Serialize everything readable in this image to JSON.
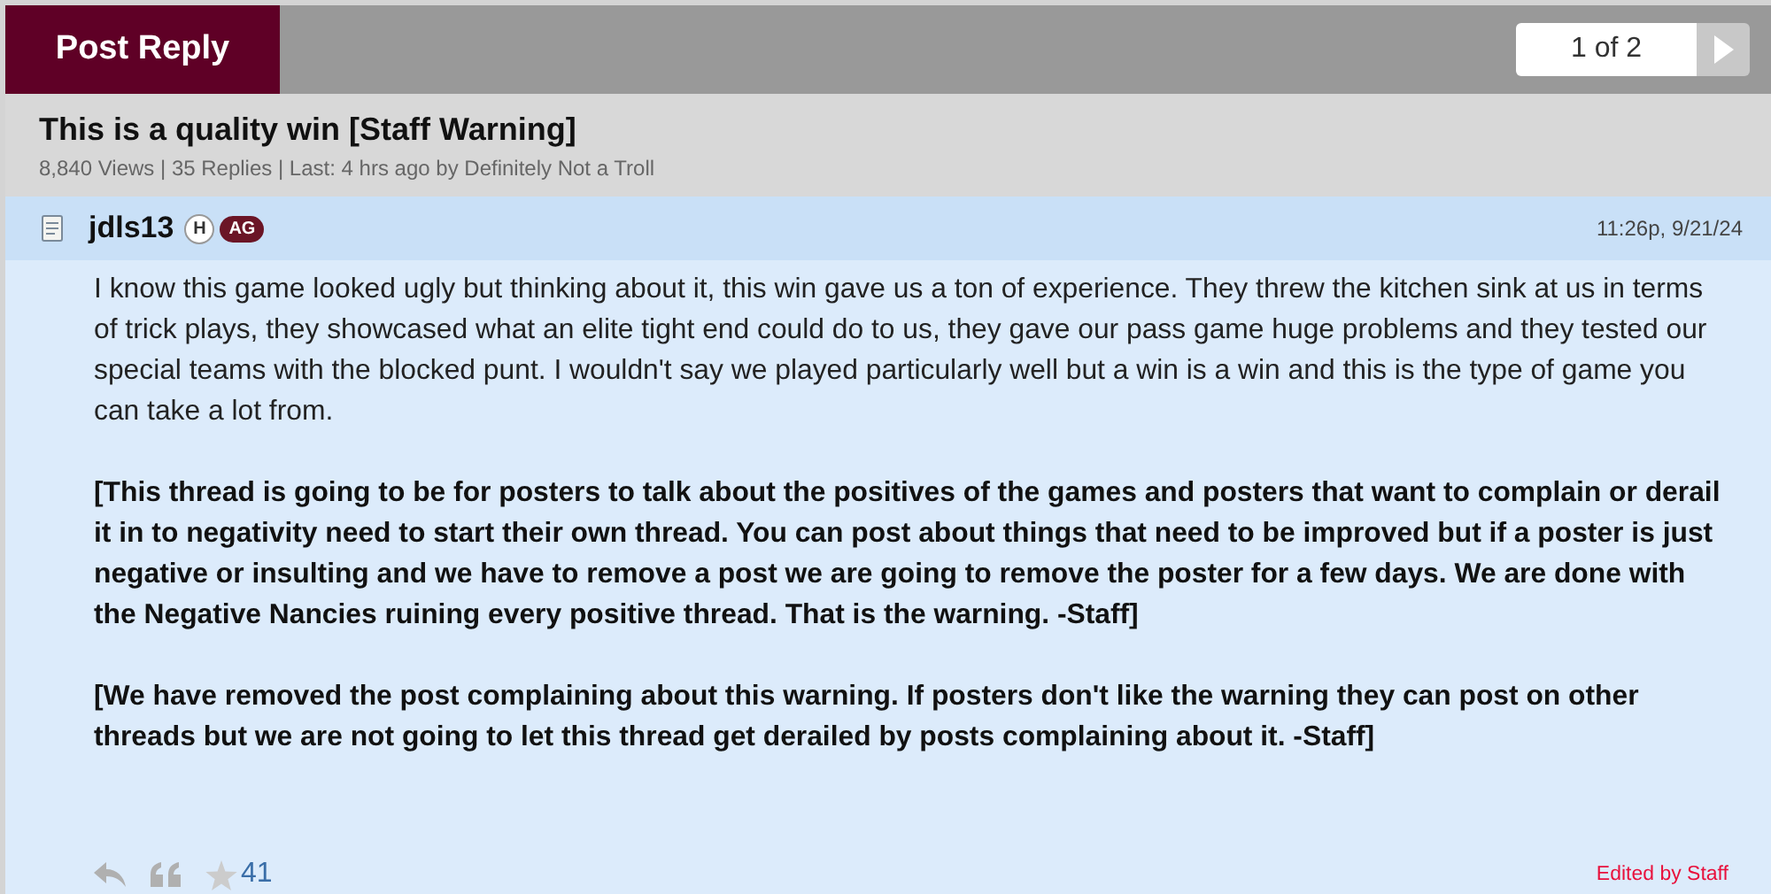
{
  "toolbar": {
    "post_reply": "Post Reply",
    "pager": "1 of 2"
  },
  "thread": {
    "title": "This is a quality win [Staff Warning]",
    "meta": "8,840 Views | 35 Replies | Last: 4 hrs ago by Definitely Not a Troll"
  },
  "post": {
    "author": "jdls13",
    "badges": [
      "H",
      "AG"
    ],
    "time": "11:26p, 9/21/24",
    "paragraphs": [
      {
        "text": "I know this game looked ugly but thinking about it, this win gave us a ton of experience. They threw the kitchen sink at us in terms of trick plays, they showcased what an elite tight end could do to us, they gave our pass game huge problems and they tested our special teams with the blocked punt. I wouldn't say we played particularly well but a win is a win and this is the type of game you can take a lot from.",
        "bold": false
      },
      {
        "text": "[This thread is going to be for posters to talk about the positives of the games and posters that want to complain or derail it in to negativity need to start their own thread. You can post about things that need to be improved but if a poster is just negative or insulting and we have to remove a post we are going to remove the poster for a few days. We are done with the Negative Nancies ruining every positive thread. That is the warning. -Staff]",
        "bold": true
      },
      {
        "text": "[We have removed the post complaining about this warning. If posters don't like the warning they can post on other threads but we are not going to let this thread get derailed by posts complaining about it. -Staff]",
        "bold": true
      }
    ],
    "stars": "41",
    "edited": "Edited by Staff"
  }
}
